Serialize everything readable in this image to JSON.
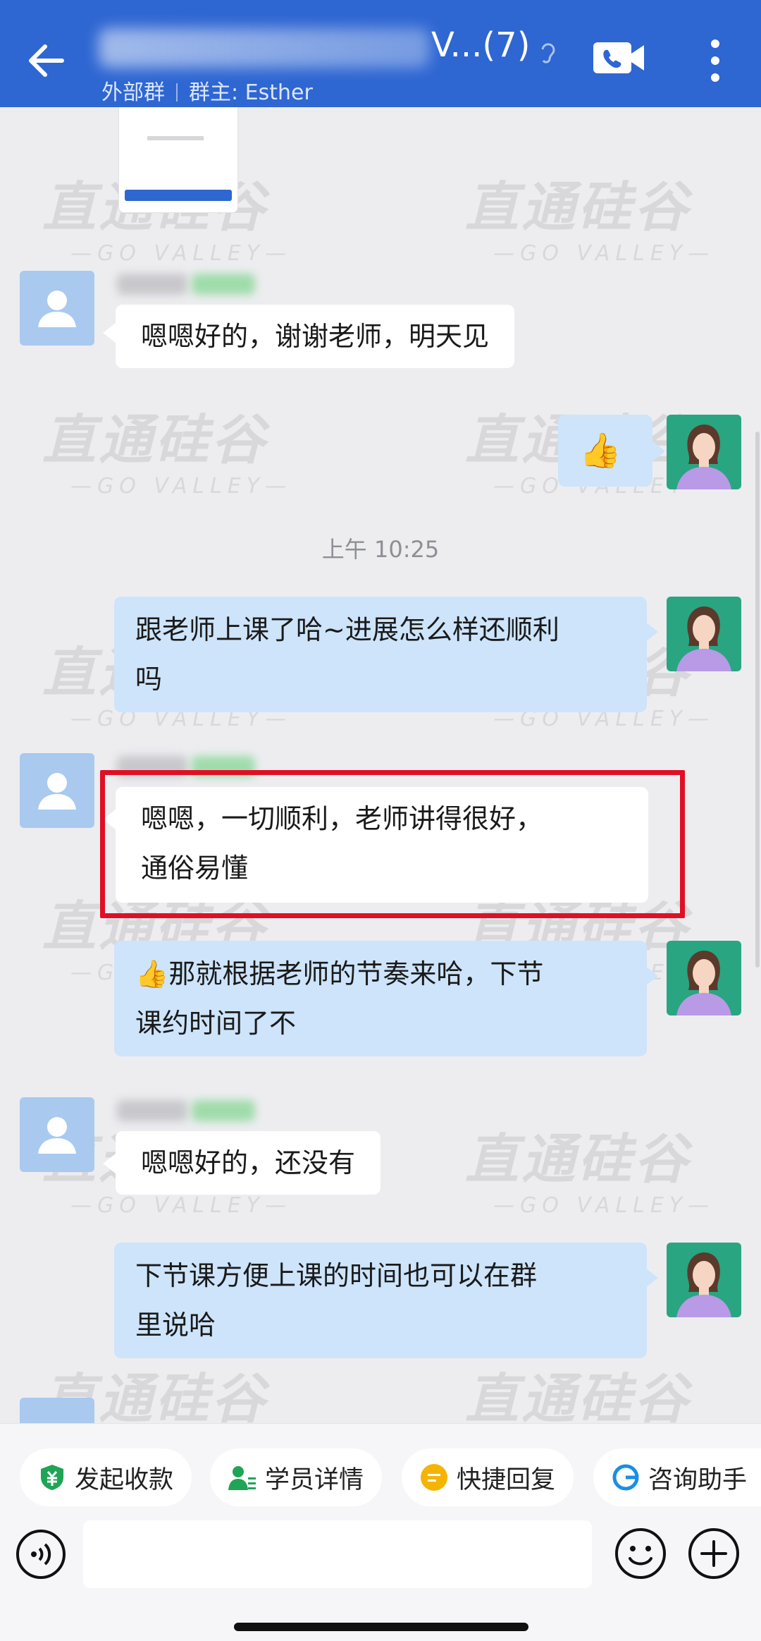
{
  "header": {
    "title_suffix": "V...(7)",
    "group_type": "外部群",
    "owner_label": "群主: Esther"
  },
  "messages": [
    {
      "id": "m1",
      "side": "left",
      "text": "嗯嗯好的，谢谢老师，明天见"
    },
    {
      "id": "m2",
      "side": "right",
      "text": "👍"
    },
    {
      "id": "ts1",
      "type": "timestamp",
      "text": "上午 10:25"
    },
    {
      "id": "m3",
      "side": "right",
      "text": "跟老师上课了哈~进展怎么样还顺利\n吗"
    },
    {
      "id": "m4",
      "side": "left",
      "text": "嗯嗯，一切顺利，老师讲得很好，\n通俗易懂",
      "highlighted": true
    },
    {
      "id": "m5",
      "side": "right",
      "text": "👍那就根据老师的节奏来哈，下节\n课约时间了不"
    },
    {
      "id": "m6",
      "side": "left",
      "text": "嗯嗯好的，还没有"
    },
    {
      "id": "m7",
      "side": "right",
      "text": "下节课方便上课的时间也可以在群\n里说哈"
    }
  ],
  "watermark": {
    "cn": "直通硅谷",
    "en": "—GO VALLEY—"
  },
  "quick_actions": [
    {
      "label": "发起收款",
      "icon": "shield-yen-icon",
      "color": "#20a456"
    },
    {
      "label": "学员详情",
      "icon": "student-icon",
      "color": "#20a456"
    },
    {
      "label": "快捷回复",
      "icon": "quick-reply-icon",
      "color": "#f4b400"
    },
    {
      "label": "咨询助手",
      "icon": "assistant-g-icon",
      "color": "#1a8fe3"
    }
  ],
  "colors": {
    "header": "#2e66d2",
    "left_bubble": "#ffffff",
    "right_bubble": "#cde4fb",
    "highlight": "#e01024",
    "teacher_avatar": "#2aa582"
  }
}
